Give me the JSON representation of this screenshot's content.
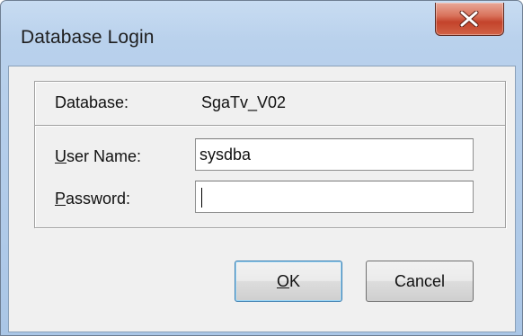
{
  "window": {
    "title": "Database Login"
  },
  "database": {
    "label": "Database:",
    "value": "SgaTv_V02"
  },
  "fields": {
    "username": {
      "label_mnemonic": "U",
      "label_rest": "ser Name:",
      "value": "sysdba"
    },
    "password": {
      "label_mnemonic": "P",
      "label_rest": "assword:",
      "value": ""
    }
  },
  "buttons": {
    "ok_mnemonic": "O",
    "ok_rest": "K",
    "cancel": "Cancel"
  },
  "icons": {
    "close": "close-icon"
  },
  "colors": {
    "close_button": "#c3432b",
    "default_button_border": "#3c7fb1"
  }
}
